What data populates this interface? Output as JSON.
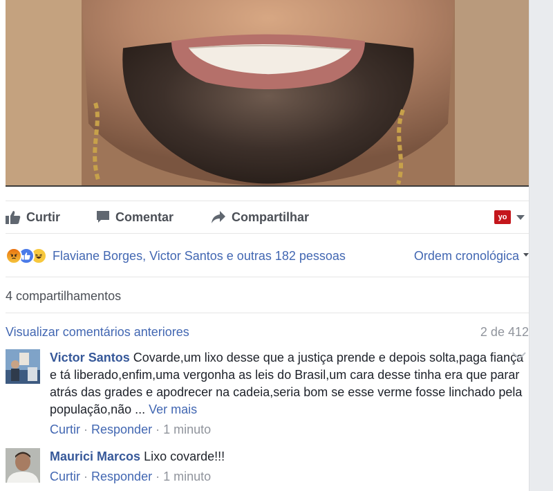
{
  "actions": {
    "like_label": "Curtir",
    "comment_label": "Comentar",
    "share_label": "Compartilhar",
    "badge_text": "yo"
  },
  "reactions": {
    "icons": [
      "angry-icon",
      "like-icon",
      "haha-icon"
    ],
    "names_text": "Flaviane Borges, Victor Santos e outras 182 pessoas",
    "order_label": "Ordem cronológica"
  },
  "shares_text": "4 compartilhamentos",
  "comments_header": {
    "view_previous": "Visualizar comentários anteriores",
    "count": "2 de 412"
  },
  "comments": [
    {
      "author": "Victor Santos",
      "text": "Covarde,um lixo desse que a justiça prende e depois solta,paga fiança e tá liberado,enfim,uma vergonha as leis do Brasil,um cara desse tinha era que parar atrás das grades e apodrecer na cadeia,seria bom se esse verme fosse linchado pela população,não ...",
      "more": "Ver mais",
      "like": "Curtir",
      "reply": "Responder",
      "time": "1 minuto"
    },
    {
      "author": "Maurici Marcos",
      "text": "Lixo covarde!!!",
      "like": "Curtir",
      "reply": "Responder",
      "time": "1 minuto"
    }
  ],
  "colors": {
    "link": "#4267b2",
    "author": "#365899",
    "muted": "#90949c",
    "action": "#4b4f56",
    "badge": "#c4161c"
  }
}
